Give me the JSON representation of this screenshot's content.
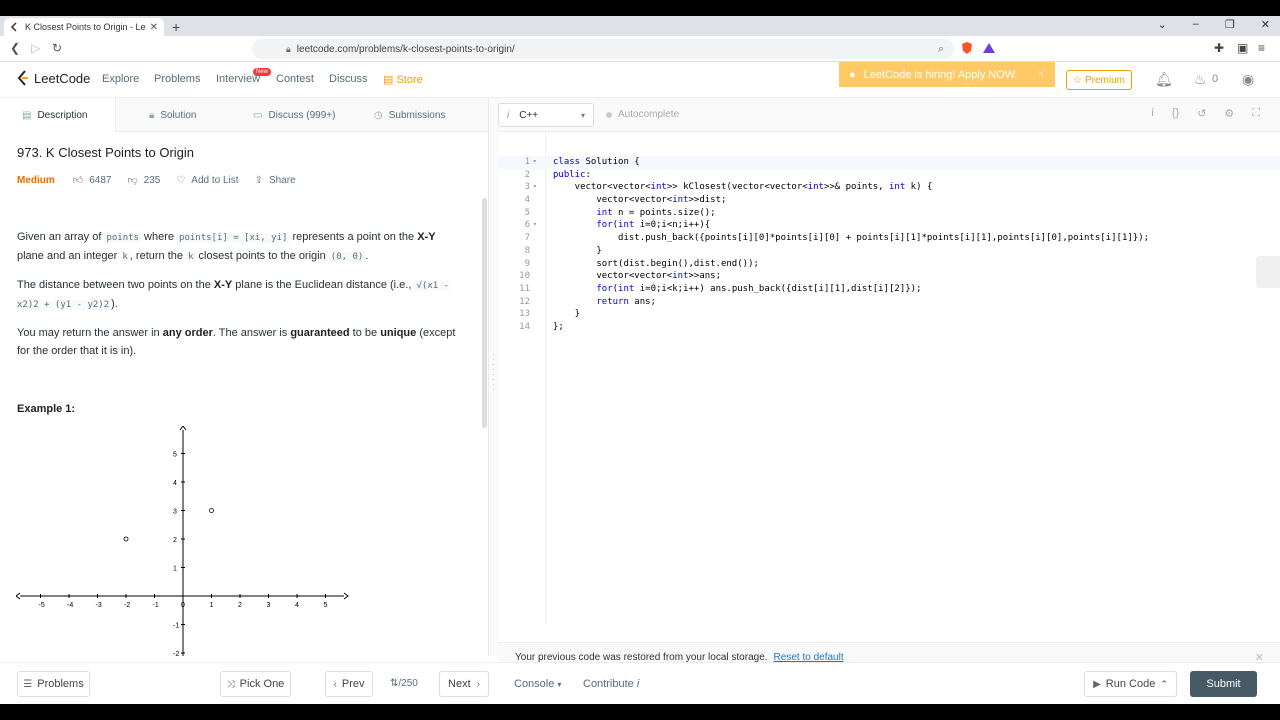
{
  "browser": {
    "tab_title": "K Closest Points to Origin - LeetC",
    "url": "leetcode.com/problems/k-closest-points-to-origin/"
  },
  "nav": {
    "logo": "LeetCode",
    "links": [
      "Explore",
      "Problems",
      "Interview",
      "Contest",
      "Discuss",
      "Store"
    ],
    "new_badge": "New",
    "hiring": "LeetCode is hiring! Apply NOW.",
    "premium": "Premium",
    "streak": "0"
  },
  "left_tabs": [
    "Description",
    "Solution",
    "Discuss (999+)",
    "Submissions"
  ],
  "problem": {
    "title": "973. K Closest Points to Origin",
    "difficulty": "Medium",
    "likes": "6487",
    "dislikes": "235",
    "add_to_list": "Add to List",
    "share": "Share",
    "p1": {
      "a": "Given an array of ",
      "c1": "points",
      "b": " where ",
      "c2": "points[i] = [xi, yi]",
      "c": " represents a point on the ",
      "d": "X-Y",
      "e": " plane and an integer ",
      "c3": "k",
      "f": ", return the ",
      "c4": "k",
      "g": " closest points to the origin ",
      "c5": "(0, 0)",
      "h": "."
    },
    "p2": {
      "a": "The distance between two points on the ",
      "b": "X-Y",
      "c": " plane is the Euclidean distance (i.e., ",
      "code": "√(x1 - x2)2 + (y1 - y2)2",
      "d": ")."
    },
    "p3": {
      "a": "You may return the answer in ",
      "b": "any order",
      "c": ". The answer is ",
      "d": "guaranteed",
      "e": " to be ",
      "f": "unique",
      "g": " (except for the order that it is in)."
    },
    "example_title": "Example 1:"
  },
  "plot_data": {
    "x_ticks": [
      "-5",
      "-4",
      "-3",
      "-2",
      "-1",
      "0",
      "1",
      "2",
      "3",
      "4",
      "5"
    ],
    "y_ticks": [
      "5",
      "4",
      "3",
      "2",
      "1",
      "-1",
      "-2"
    ],
    "points": [
      {
        "x": -2,
        "y": 2
      },
      {
        "x": 1,
        "y": 3
      }
    ]
  },
  "editor": {
    "language": "C++",
    "autocomplete": "Autocomplete",
    "lines": [
      {
        "n": "1",
        "fold": "▾",
        "text": "class Solution {"
      },
      {
        "n": "2",
        "fold": "",
        "text": "public:"
      },
      {
        "n": "3",
        "fold": "▾",
        "text": "    vector<vector<int>> kClosest(vector<vector<int>>& points, int k) {"
      },
      {
        "n": "4",
        "fold": "",
        "text": "        vector<vector<int>>dist;"
      },
      {
        "n": "5",
        "fold": "",
        "text": "        int n = points.size();"
      },
      {
        "n": "6",
        "fold": "▾",
        "text": "        for(int i=0;i<n;i++){"
      },
      {
        "n": "7",
        "fold": "",
        "text": "            dist.push_back({points[i][0]*points[i][0] + points[i][1]*points[i][1],points[i][0],points[i][1]});"
      },
      {
        "n": "8",
        "fold": "",
        "text": "        }"
      },
      {
        "n": "9",
        "fold": "",
        "text": "        sort(dist.begin(),dist.end());"
      },
      {
        "n": "10",
        "fold": "",
        "text": "        vector<vector<int>>ans;"
      },
      {
        "n": "11",
        "fold": "",
        "text": "        for(int i=0;i<k;i++) ans.push_back({dist[i][1],dist[i][2]});"
      },
      {
        "n": "12",
        "fold": "",
        "text": "        return ans;"
      },
      {
        "n": "13",
        "fold": "",
        "text": "    }"
      },
      {
        "n": "14",
        "fold": "",
        "text": "};"
      }
    ],
    "restore_msg": "Your previous code was restored from your local storage.",
    "reset": "Reset to default"
  },
  "bottom": {
    "problems": "Problems",
    "pick_one": "Pick One",
    "prev": "Prev",
    "pager": "/250",
    "next": "Next",
    "console": "Console",
    "contribute": "Contribute",
    "run_code": "Run Code",
    "submit": "Submit"
  }
}
